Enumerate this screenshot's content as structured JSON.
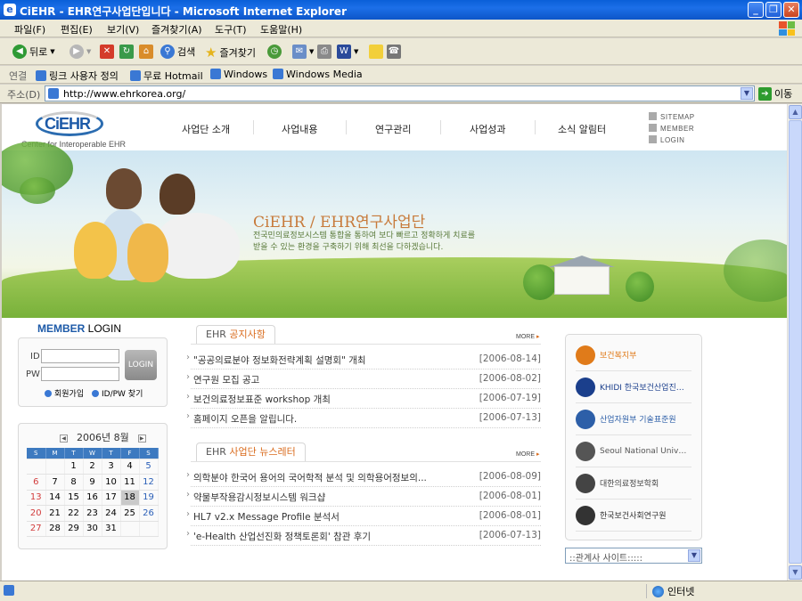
{
  "window": {
    "title": "CiEHR - EHR연구사업단입니다 - Microsoft Internet Explorer"
  },
  "menu": [
    "파일(F)",
    "편집(E)",
    "보기(V)",
    "즐겨찾기(A)",
    "도구(T)",
    "도움말(H)"
  ],
  "toolbar": {
    "back": "뒤로",
    "search": "검색",
    "favorites": "즐겨찾기"
  },
  "links": {
    "label": "연결",
    "items": [
      "링크 사용자 정의",
      "무료 Hotmail",
      "Windows",
      "Windows Media"
    ]
  },
  "address": {
    "label": "주소(D)",
    "url": "http://www.ehrkorea.org/",
    "go": "이동"
  },
  "status": {
    "zone": "인터넷"
  },
  "site": {
    "logo": "CiEHR",
    "logo_sub": "Center for Interoperable EHR",
    "nav": [
      "사업단 소개",
      "사업내용",
      "연구관리",
      "사업성과",
      "소식 알림터"
    ],
    "util": [
      "SITEMAP",
      "MEMBER",
      "LOGIN"
    ],
    "hero": {
      "title": "CiEHR / EHR연구사업단",
      "desc": "전국민의료정보시스템 통합을 통하여 보다 빠르고 정확하게 치료를 받을 수 있는 환경을 구축하기 위해 최선을 다하겠습니다."
    },
    "member": {
      "title_strong": "MEMBER",
      "title_rest": " LOGIN",
      "id_label": "ID",
      "pw_label": "PW",
      "login_btn": "LOGIN",
      "join": "회원가입",
      "find": "ID/PW 찾기"
    },
    "calendar": {
      "title": "2006년 8월",
      "days": [
        "S",
        "M",
        "T",
        "W",
        "T",
        "F",
        "S"
      ],
      "weeks": [
        [
          "",
          "",
          "1",
          "2",
          "3",
          "4",
          "5"
        ],
        [
          "6",
          "7",
          "8",
          "9",
          "10",
          "11",
          "12"
        ],
        [
          "13",
          "14",
          "15",
          "16",
          "17",
          "18",
          "19"
        ],
        [
          "20",
          "21",
          "22",
          "23",
          "24",
          "25",
          "26"
        ],
        [
          "27",
          "28",
          "29",
          "30",
          "31",
          "",
          ""
        ]
      ],
      "today": "18"
    },
    "notice": {
      "tab_prefix": "EHR ",
      "tab_strong": "공지사항",
      "more": "MORE",
      "items": [
        {
          "title": "\"공공의료분야 정보화전략계획 설명회\" 개최",
          "date": "[2006-08-14]"
        },
        {
          "title": "연구원 모집 공고",
          "date": "[2006-08-02]"
        },
        {
          "title": "보건의료정보표준 workshop 개최",
          "date": "[2006-07-19]"
        },
        {
          "title": "홈페이지 오픈을 알립니다.",
          "date": "[2006-07-13]"
        }
      ]
    },
    "newsletter": {
      "tab_prefix": "EHR ",
      "tab_strong": "사업단 뉴스레터",
      "more": "MORE",
      "items": [
        {
          "title": "의학분야 한국어 용어의 국어학적 분석 및 의학용어정보의...",
          "date": "[2006-08-09]"
        },
        {
          "title": "약물부작용감시정보시스템 워크샵",
          "date": "[2006-08-01]"
        },
        {
          "title": "HL7 v2.x Message Profile 분석서",
          "date": "[2006-08-01]"
        },
        {
          "title": "'e-Health 산업선진화 정책토론회' 참관 후기",
          "date": "[2006-07-13]"
        }
      ]
    },
    "orgs": [
      {
        "name": "보건복지부",
        "color": "#e07b1a"
      },
      {
        "name": "KHIDI 한국보건산업진흥원",
        "color": "#1b3f8c"
      },
      {
        "name": "산업자원부 기술표준원",
        "color": "#2d5fa8"
      },
      {
        "name": "Seoul National University College of Medicine",
        "color": "#555555"
      },
      {
        "name": "대한의료정보학회",
        "color": "#444444"
      },
      {
        "name": "한국보건사회연구원",
        "color": "#333333"
      }
    ],
    "related_select": "::관계사 사이트:::::"
  }
}
